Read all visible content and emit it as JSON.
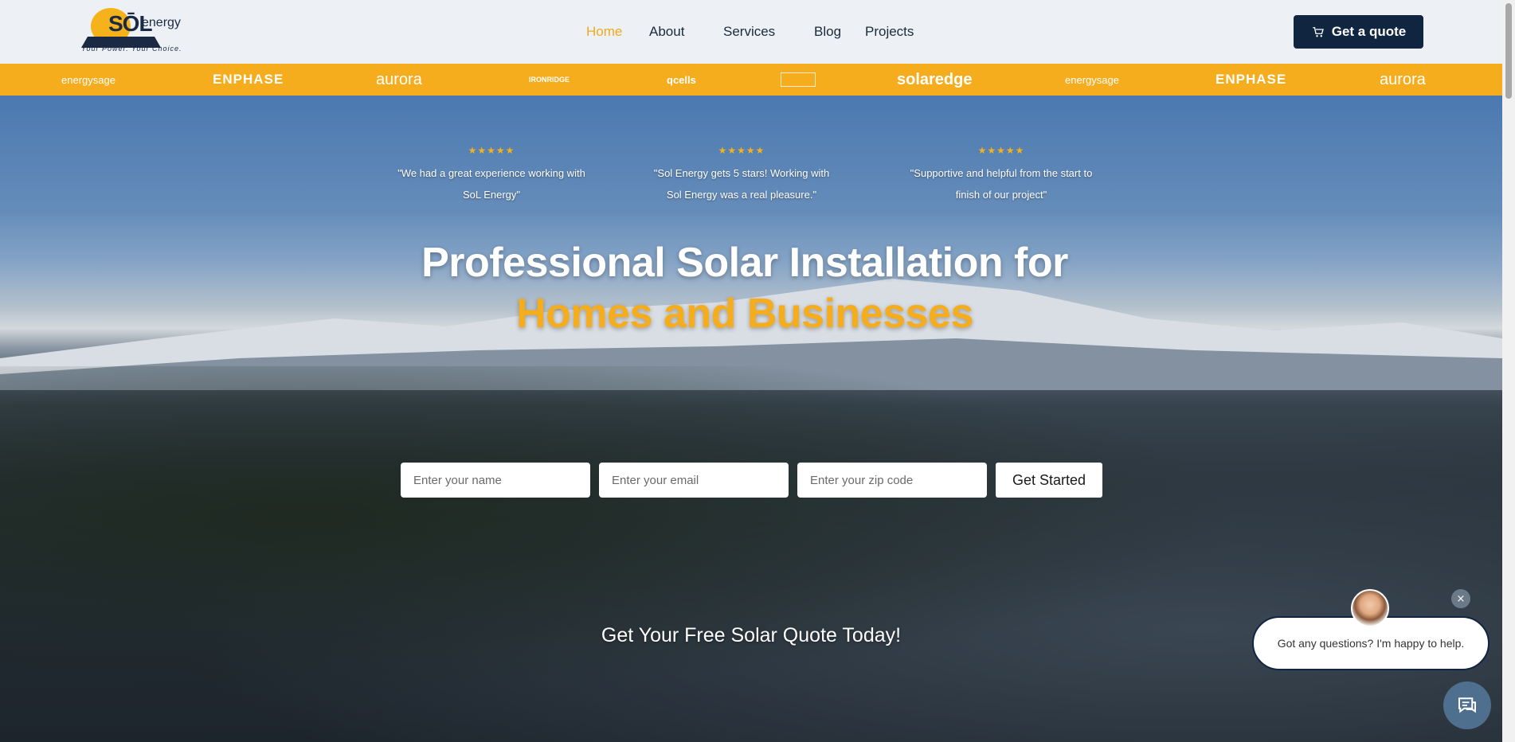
{
  "brand": {
    "logo_so": "SŌL",
    "logo_energy": "energy",
    "tagline": "Your Power. Your Choice."
  },
  "nav": {
    "items": [
      {
        "label": "Home",
        "active": true
      },
      {
        "label": "About",
        "active": false
      },
      {
        "label": "Services",
        "active": false
      },
      {
        "label": "Blog",
        "active": false
      },
      {
        "label": "Projects",
        "active": false
      }
    ],
    "quote_button": "Get a quote"
  },
  "partners": [
    "energysage",
    "ENPHASE",
    "aurora",
    "IRONRIDGE",
    "qcells",
    "",
    "solaredge",
    "energysage",
    "ENPHASE",
    "aurora"
  ],
  "reviews": [
    {
      "stars": "★★★★★",
      "text": "\"We had a great experience working with SoL Energy\""
    },
    {
      "stars": "★★★★★",
      "text": "\"Sol Energy gets 5 stars! Working with Sol Energy was a real pleasure.\""
    },
    {
      "stars": "★★★★★",
      "text": "\"Supportive and helpful from the start to finish of our project\""
    }
  ],
  "hero": {
    "headline_line1": "Professional Solar Installation for",
    "headline_line2": "Homes and Businesses"
  },
  "form": {
    "name_placeholder": "Enter your name",
    "email_placeholder": "Enter your email",
    "zip_placeholder": "Enter your zip code",
    "submit_label": "Get Started"
  },
  "cta": "Get Your Free Solar Quote Today!",
  "chat": {
    "message": "Got any questions? I'm happy to help.",
    "close": "×"
  },
  "colors": {
    "accent": "#f5ad1e",
    "navy": "#0f2540",
    "header_bg": "#edf1f5"
  }
}
